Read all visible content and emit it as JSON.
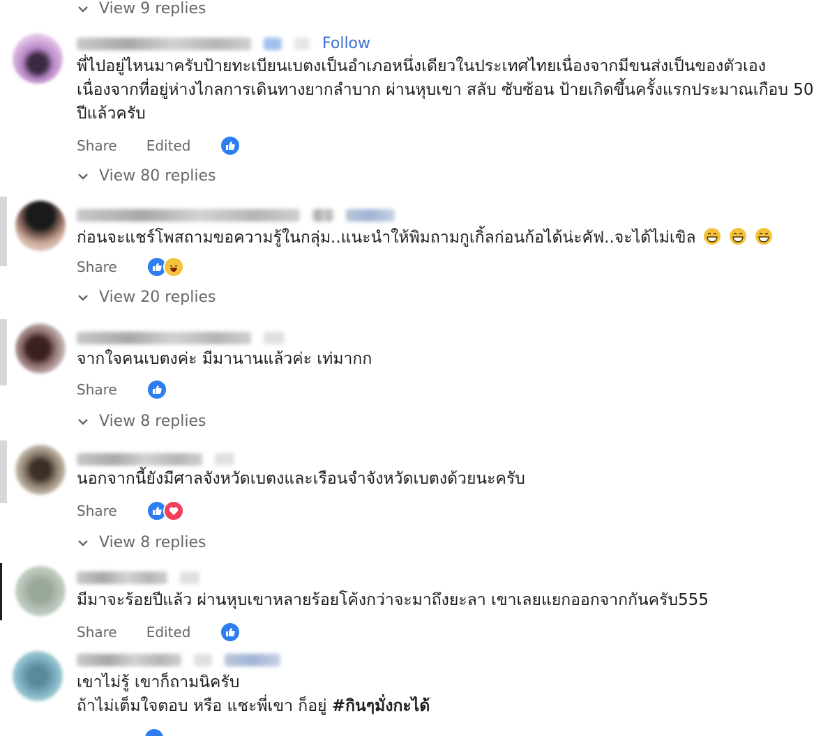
{
  "comments": [
    {
      "follow_label": "Follow",
      "text": "พี่ไปอยู่ไหนมาครับป้ายทะเบียนเบตงเป็นอำเภอหนึ่งเดียวในประเทศไทยเนื่องจากมีขนส่งเป็นของตัวเองเนื่องจากที่อยู่ห่างไกลการเดินทางยากลำบาก ผ่านหุบเขา สลับ ซับซ้อน ป้ายเกิดขึ้นครั้งแรกประมาณเกือบ 50 ปีแล้วครับ",
      "share_label": "Share",
      "edited_label": "Edited",
      "reactions": [
        "like"
      ],
      "view_replies": "View 80 replies"
    },
    {
      "text": "ก่อนจะแชร์โพสถามขอความรู้ในกลุ่ม..แนะนำให้พิมถามกูเกิ้ลก่อนก้อได้น่ะคัฟ..จะได้ไม่เขิล",
      "trailing_emoji": [
        "grinning-face",
        "grinning-face",
        "grinning-face"
      ],
      "share_label": "Share",
      "reactions": [
        "like",
        "haha"
      ],
      "view_replies": "View 20 replies"
    },
    {
      "text": "จากใจคนเบตงค่ะ มีมานานแล้วค่ะ เท่มากก",
      "share_label": "Share",
      "reactions": [
        "like"
      ],
      "view_replies": "View 8 replies"
    },
    {
      "text": "นอกจากนี้ยังมีศาลจังหวัดเบตงและเรือนจำจังหวัดเบตงด้วยนะครับ",
      "share_label": "Share",
      "reactions": [
        "like",
        "love"
      ],
      "view_replies": "View 8 replies"
    },
    {
      "text": "มีมาจะร้อยปีแล้ว ผ่านหุบเขาหลายร้อยโค้งกว่าจะมาถึงยะลา เขาเลยแยกออกจากกันครับ555",
      "share_label": "Share",
      "edited_label": "Edited",
      "reactions": [
        "like"
      ]
    },
    {
      "text_line1": "เขาไม่รู้ เขาก็ถามนิครับ",
      "text_line2_prefix": "ถ้าไม่เต็มใจตอบ หรือ แชะพี่เขา ก็อยู่ ",
      "hashtag": "#กินๆมั่งกะได้",
      "reactions": [
        "like"
      ]
    }
  ],
  "top_view_replies": "View 9 replies",
  "colors": {
    "link_blue": "#3a6fd4",
    "like_blue": "#2d7ef0",
    "muted_text": "#65676b",
    "haha_yellow": "#f5c33b",
    "love_red": "#f0405a"
  }
}
